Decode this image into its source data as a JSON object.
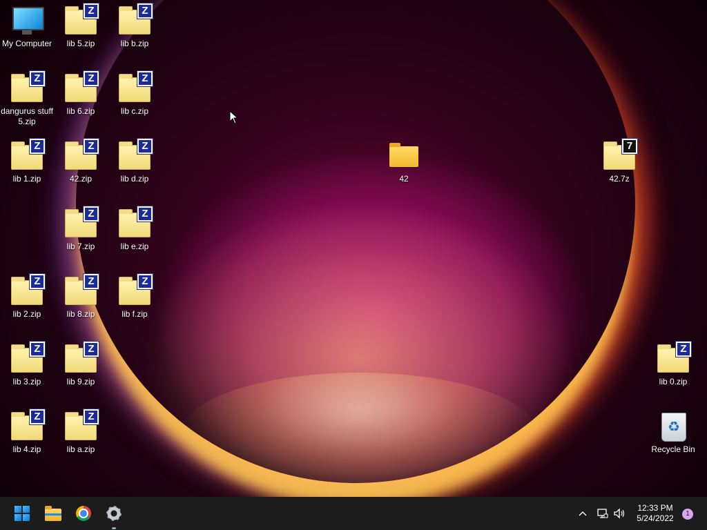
{
  "desktop": {
    "icons": [
      {
        "label": "My Computer",
        "kind": "monitor-icon",
        "col": 0,
        "row": 0
      },
      {
        "label": "lib 5.zip",
        "kind": "zip-icon",
        "col": 1,
        "row": 0
      },
      {
        "label": "lib b.zip",
        "kind": "zip-icon",
        "col": 2,
        "row": 0
      },
      {
        "label": "dangurus stuff 5.zip",
        "kind": "zip-icon",
        "col": 0,
        "row": 1
      },
      {
        "label": "lib 6.zip",
        "kind": "zip-icon",
        "col": 1,
        "row": 1
      },
      {
        "label": "lib c.zip",
        "kind": "zip-icon",
        "col": 2,
        "row": 1
      },
      {
        "label": "lib 1.zip",
        "kind": "zip-icon",
        "col": 0,
        "row": 2
      },
      {
        "label": "42.zip",
        "kind": "zip-icon",
        "col": 1,
        "row": 2
      },
      {
        "label": "lib d.zip",
        "kind": "zip-icon",
        "col": 2,
        "row": 2
      },
      {
        "label": "lib 7.zip",
        "kind": "zip-icon",
        "col": 1,
        "row": 3
      },
      {
        "label": "lib e.zip",
        "kind": "zip-icon",
        "col": 2,
        "row": 3
      },
      {
        "label": "lib 2.zip",
        "kind": "zip-icon",
        "col": 0,
        "row": 4
      },
      {
        "label": "lib 8.zip",
        "kind": "zip-icon",
        "col": 1,
        "row": 4
      },
      {
        "label": "lib f.zip",
        "kind": "zip-icon",
        "col": 2,
        "row": 4
      },
      {
        "label": "lib 3.zip",
        "kind": "zip-icon",
        "col": 0,
        "row": 5
      },
      {
        "label": "lib 9.zip",
        "kind": "zip-icon",
        "col": 1,
        "row": 5
      },
      {
        "label": "lib 4.zip",
        "kind": "zip-icon",
        "col": 0,
        "row": 6
      },
      {
        "label": "lib a.zip",
        "kind": "zip-icon",
        "col": 1,
        "row": 6
      },
      {
        "label": "42",
        "kind": "folder-icon",
        "col": 7,
        "row": 2
      },
      {
        "label": "42.7z",
        "kind": "sevenzip-icon",
        "col": 11,
        "row": 2
      },
      {
        "label": "lib 0.zip",
        "kind": "zip-icon",
        "col": 12,
        "row": 5
      },
      {
        "label": "Recycle Bin",
        "kind": "recycle-bin-icon",
        "col": 12,
        "row": 6
      }
    ],
    "zip_badge_letter": "Z",
    "sevenzip_badge_letter": "7"
  },
  "taskbar": {
    "apps": [
      {
        "name": "start-button",
        "icon": "windows-logo-icon"
      },
      {
        "name": "file-explorer-button",
        "icon": "folder-icon"
      },
      {
        "name": "chrome-button",
        "icon": "chrome-icon"
      },
      {
        "name": "settings-button",
        "icon": "gear-icon"
      }
    ],
    "tray": {
      "chevron": "^",
      "clock_time": "12:33 PM",
      "clock_date": "5/24/2022",
      "notification_count": "1"
    }
  },
  "colors": {
    "taskbar_bg": "#1c1c1c",
    "accent": "#0078d4",
    "zip_badge": "#1d2a9c"
  }
}
